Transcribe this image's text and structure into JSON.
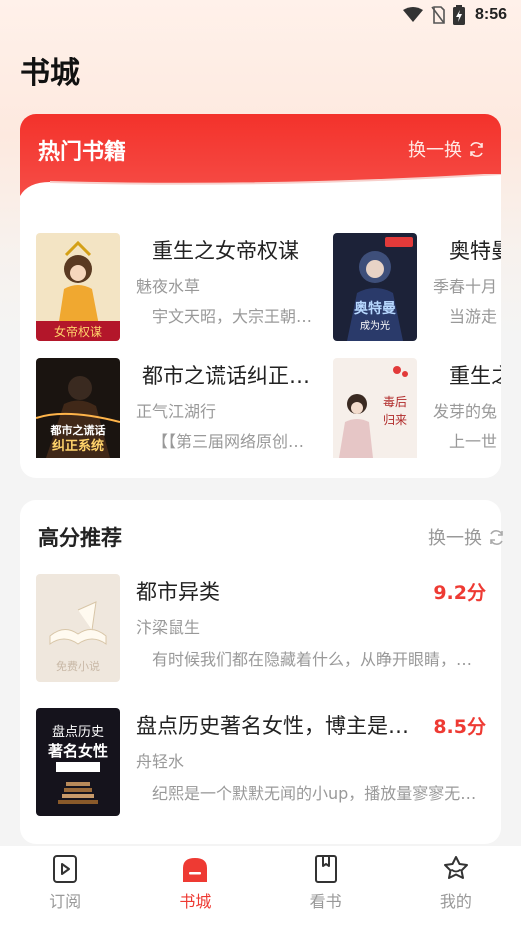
{
  "status_bar": {
    "time": "8:56"
  },
  "page_title": "书城",
  "hot": {
    "title": "热门书籍",
    "refresh_label": "换一换",
    "books": [
      {
        "title": "重生之女帝权谋",
        "author": "魅夜水草",
        "desc": "宇文天昭，大宗王朝…"
      },
      {
        "title": "奥特曼",
        "author": "季春十月",
        "desc": "当游走"
      },
      {
        "title": "都市之谎话纠正…",
        "author": "正气江湖行",
        "desc": "【【第三届网络原创…"
      },
      {
        "title": "重生之",
        "author": "发芽的兔",
        "desc": "上一世"
      }
    ]
  },
  "recommend": {
    "title": "高分推荐",
    "refresh_label": "换一换",
    "books": [
      {
        "title": "都市异类",
        "author": "汴梁鼠生",
        "score": "9.2分",
        "desc": "有时候我们都在隐藏着什么，从睁开眼睛，…"
      },
      {
        "title": "盘点历史著名女性，博主是…",
        "author": "舟轻水",
        "score": "8.5分",
        "desc": "纪熙是一个默默无闻的小up，播放量寥寥无…"
      }
    ]
  },
  "nav": [
    {
      "label": "订阅",
      "icon": "subscribe-icon",
      "active": false
    },
    {
      "label": "书城",
      "icon": "bookstore-icon",
      "active": true
    },
    {
      "label": "看书",
      "icon": "book-icon",
      "active": false
    },
    {
      "label": "我的",
      "icon": "profile-icon",
      "active": false
    }
  ],
  "colors": {
    "accent": "#ee3a33",
    "header_red": "#f3322b",
    "muted": "#999999"
  }
}
